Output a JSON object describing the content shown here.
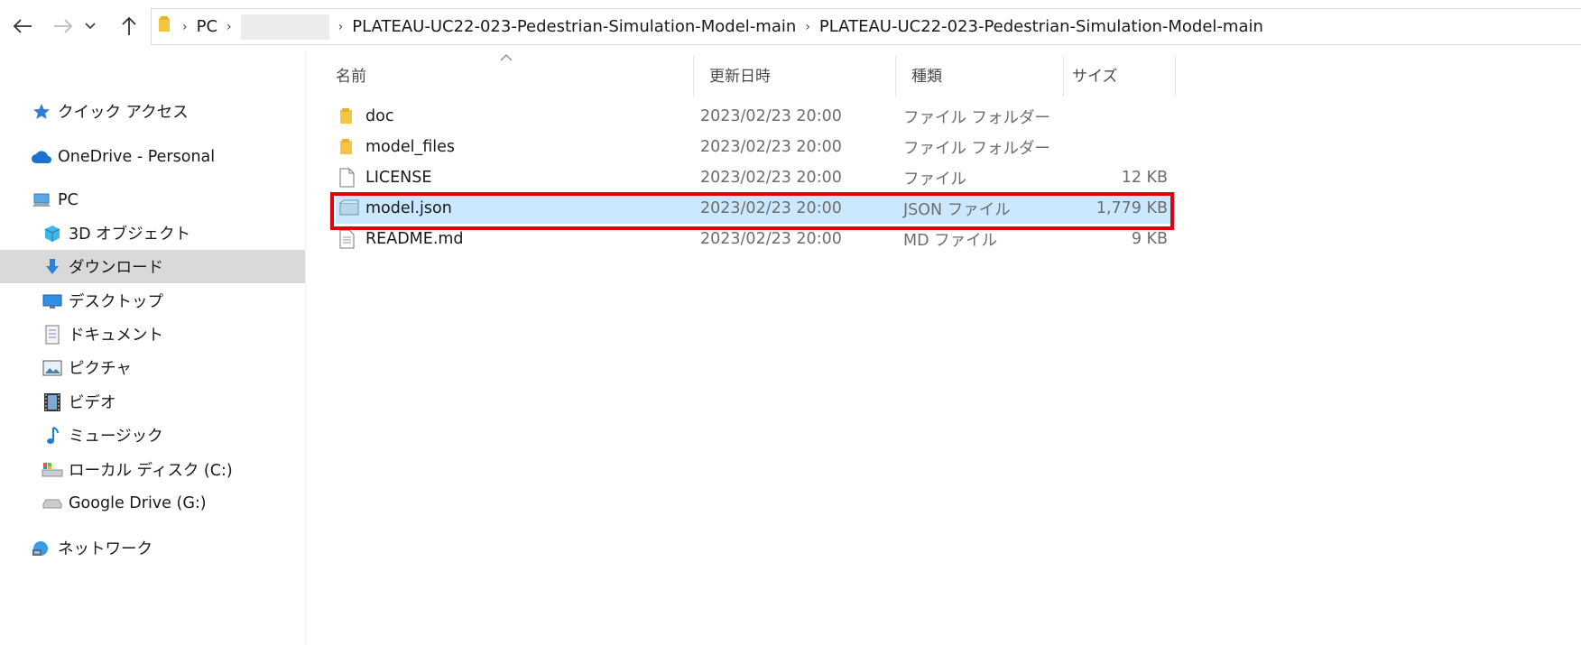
{
  "window": {
    "breadcrumb": [
      "PC",
      "",
      "PLATEAU-UC22-023-Pedestrian-Simulation-Model-main",
      "PLATEAU-UC22-023-Pedestrian-Simulation-Model-main"
    ]
  },
  "nav": {
    "back_icon": "arrow-left-icon",
    "forward_icon": "arrow-right-icon",
    "recent_icon": "chevron-down-icon",
    "up_icon": "arrow-up-icon"
  },
  "sidebar": {
    "items": [
      {
        "label": "クイック アクセス",
        "icon": "star-icon"
      },
      {
        "label": "OneDrive - Personal",
        "icon": "cloud-icon"
      },
      {
        "label": "PC",
        "icon": "pc-icon"
      },
      {
        "label": "3D オブジェクト",
        "icon": "cube-icon"
      },
      {
        "label": "ダウンロード",
        "icon": "download-icon",
        "selected": true
      },
      {
        "label": "デスクトップ",
        "icon": "desktop-icon"
      },
      {
        "label": "ドキュメント",
        "icon": "document-icon"
      },
      {
        "label": "ピクチャ",
        "icon": "picture-icon"
      },
      {
        "label": "ビデオ",
        "icon": "video-icon"
      },
      {
        "label": "ミュージック",
        "icon": "music-icon"
      },
      {
        "label": "ローカル ディスク (C:)",
        "icon": "drive-icon"
      },
      {
        "label": "Google Drive (G:)",
        "icon": "drive-icon"
      },
      {
        "label": "ネットワーク",
        "icon": "network-icon"
      }
    ]
  },
  "columns": {
    "name": "名前",
    "modified": "更新日時",
    "type": "種類",
    "size": "サイズ"
  },
  "files": [
    {
      "name": "doc",
      "modified": "2023/02/23 20:00",
      "type": "ファイル フォルダー",
      "size": "",
      "icon": "folder-icon"
    },
    {
      "name": "model_files",
      "modified": "2023/02/23 20:00",
      "type": "ファイル フォルダー",
      "size": "",
      "icon": "folder-icon"
    },
    {
      "name": "LICENSE",
      "modified": "2023/02/23 20:00",
      "type": "ファイル",
      "size": "12 KB",
      "icon": "file-icon"
    },
    {
      "name": "model.json",
      "modified": "2023/02/23 20:00",
      "type": "JSON ファイル",
      "size": "1,779 KB",
      "icon": "json-file-icon",
      "selected": true
    },
    {
      "name": "README.md",
      "modified": "2023/02/23 20:00",
      "type": "MD ファイル",
      "size": "9 KB",
      "icon": "text-file-icon"
    }
  ],
  "colors": {
    "selection": "#cce8ff",
    "sidebar_selected": "#d9d9d9",
    "annotation_box": "#e00012",
    "folder": "#f4c542"
  }
}
